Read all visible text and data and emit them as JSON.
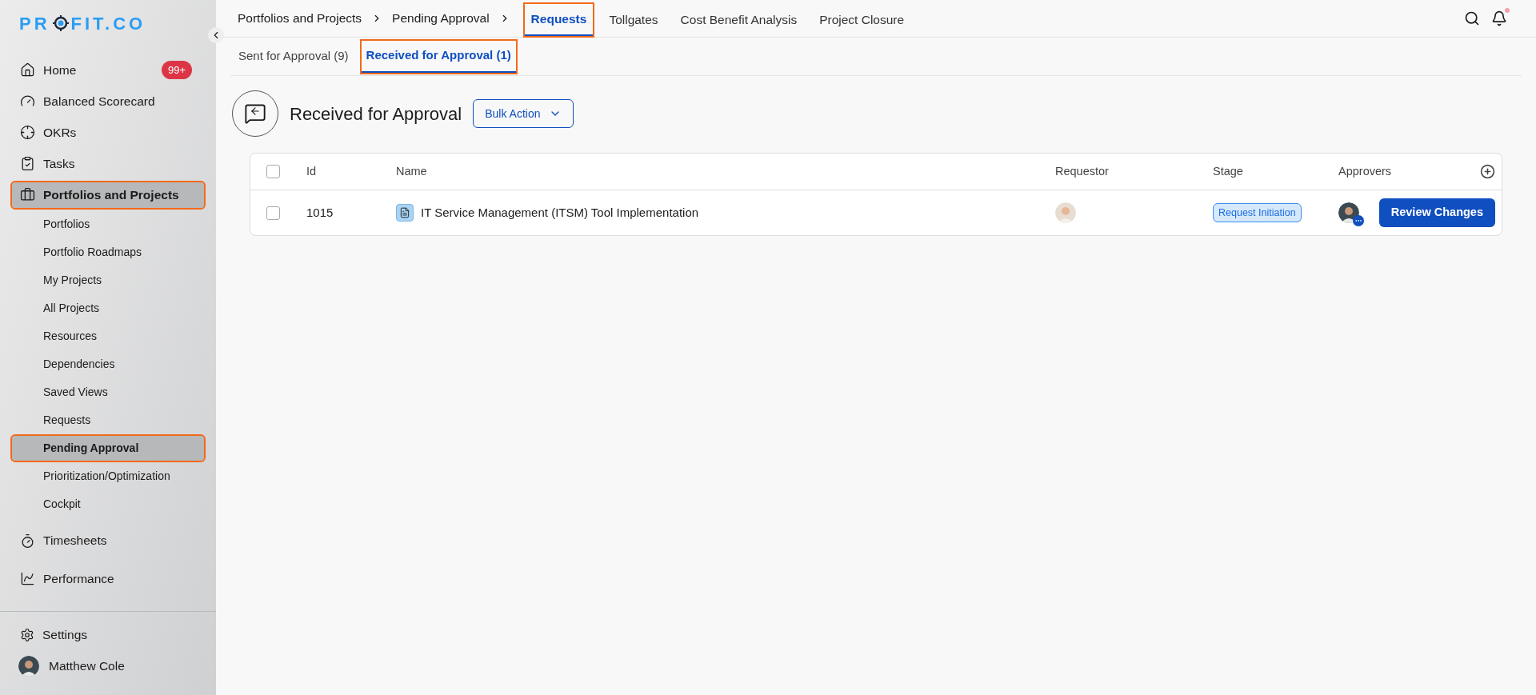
{
  "logo": {
    "before": "PR",
    "after": "FIT.CO"
  },
  "sidebar": {
    "items": [
      {
        "kind": "main",
        "label": "Home",
        "badge": "99+",
        "selected": false,
        "highlighted": false
      },
      {
        "kind": "main",
        "label": "Balanced Scorecard",
        "selected": false,
        "highlighted": false
      },
      {
        "kind": "main",
        "label": "OKRs",
        "selected": false,
        "highlighted": false
      },
      {
        "kind": "main",
        "label": "Tasks",
        "selected": false,
        "highlighted": false
      },
      {
        "kind": "main",
        "label": "Portfolios and Projects",
        "selected": true,
        "highlighted": true
      },
      {
        "kind": "sub",
        "label": "Portfolios",
        "selected": false,
        "highlighted": false
      },
      {
        "kind": "sub",
        "label": "Portfolio Roadmaps",
        "selected": false,
        "highlighted": false
      },
      {
        "kind": "sub",
        "label": "My Projects",
        "selected": false,
        "highlighted": false
      },
      {
        "kind": "sub",
        "label": "All Projects",
        "selected": false,
        "highlighted": false
      },
      {
        "kind": "sub",
        "label": "Resources",
        "selected": false,
        "highlighted": false
      },
      {
        "kind": "sub",
        "label": "Dependencies",
        "selected": false,
        "highlighted": false
      },
      {
        "kind": "sub",
        "label": "Saved Views",
        "selected": false,
        "highlighted": false
      },
      {
        "kind": "sub",
        "label": "Requests",
        "selected": false,
        "highlighted": false
      },
      {
        "kind": "sub",
        "label": "Pending Approval",
        "selected": true,
        "highlighted": true
      },
      {
        "kind": "sub",
        "label": "Prioritization/Optimization",
        "selected": false,
        "highlighted": false
      },
      {
        "kind": "sub",
        "label": "Cockpit",
        "selected": false,
        "highlighted": false
      },
      {
        "kind": "main",
        "label": "Timesheets",
        "selected": false,
        "highlighted": false
      },
      {
        "kind": "main",
        "label": "Performance",
        "selected": false,
        "highlighted": false
      }
    ],
    "settings": "Settings",
    "user": "Matthew Cole"
  },
  "breadcrumb": [
    "Portfolios and Projects",
    "Pending Approval"
  ],
  "top_tabs": [
    {
      "label": "Requests",
      "selected": true,
      "highlighted": true
    },
    {
      "label": "Tollgates",
      "selected": false,
      "highlighted": false
    },
    {
      "label": "Cost Benefit Analysis",
      "selected": false,
      "highlighted": false
    },
    {
      "label": "Project Closure",
      "selected": false,
      "highlighted": false
    }
  ],
  "notifications": {
    "unread": true
  },
  "sub_tabs": [
    {
      "label": "Sent for Approval (9)",
      "selected": false,
      "highlighted": false
    },
    {
      "label": "Received for Approval (1)",
      "selected": true,
      "highlighted": true
    }
  ],
  "heading": "Received for Approval",
  "bulk_action": "Bulk Action",
  "table": {
    "all_checked": false,
    "columns": [
      "Id",
      "Name",
      "Requestor",
      "Stage",
      "Approvers"
    ],
    "rows": [
      {
        "checked": false,
        "id": "1015",
        "name": "IT Service Management (ITSM) Tool Implementation",
        "stage": "Request Initiation",
        "action": "Review Changes"
      }
    ]
  }
}
